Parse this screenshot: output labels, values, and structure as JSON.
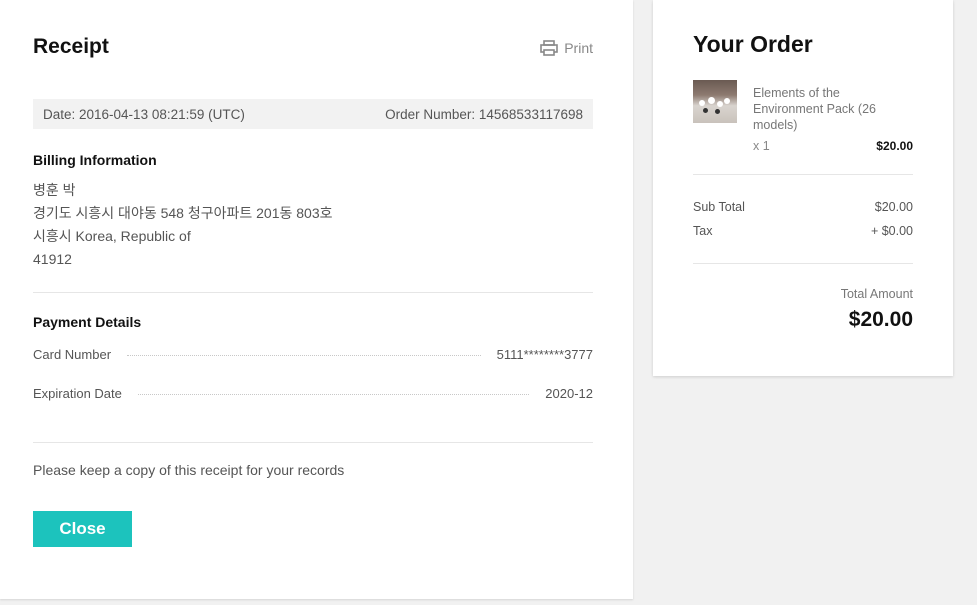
{
  "receipt": {
    "title": "Receipt",
    "print_label": "Print",
    "date_text": "Date: 2016-04-13 08:21:59 (UTC)",
    "order_number_text": "Order Number: 14568533117698",
    "billing": {
      "title": "Billing Information",
      "lines": [
        "병훈 박",
        "경기도 시흥시 대야동 548 청구아파트 201동 803호",
        "시흥시 Korea, Republic of",
        "41912"
      ]
    },
    "payment": {
      "title": "Payment Details",
      "card_label": "Card Number",
      "card_value": "5111********3777",
      "exp_label": "Expiration Date",
      "exp_value": "2020-12"
    },
    "note": "Please keep a copy of this receipt for your records",
    "close_label": "Close",
    "close_color": "#1cc3bd"
  },
  "order": {
    "title": "Your Order",
    "item": {
      "name": "Elements of the Environment Pack (26 models)",
      "qty": "x 1",
      "price": "$20.00",
      "thumbnail_icon": "product-thumbnail"
    },
    "subtotal_label": "Sub Total",
    "subtotal_value": "$20.00",
    "tax_label": "Tax",
    "tax_value": "+ $0.00",
    "total_label": "Total Amount",
    "total_value": "$20.00"
  }
}
